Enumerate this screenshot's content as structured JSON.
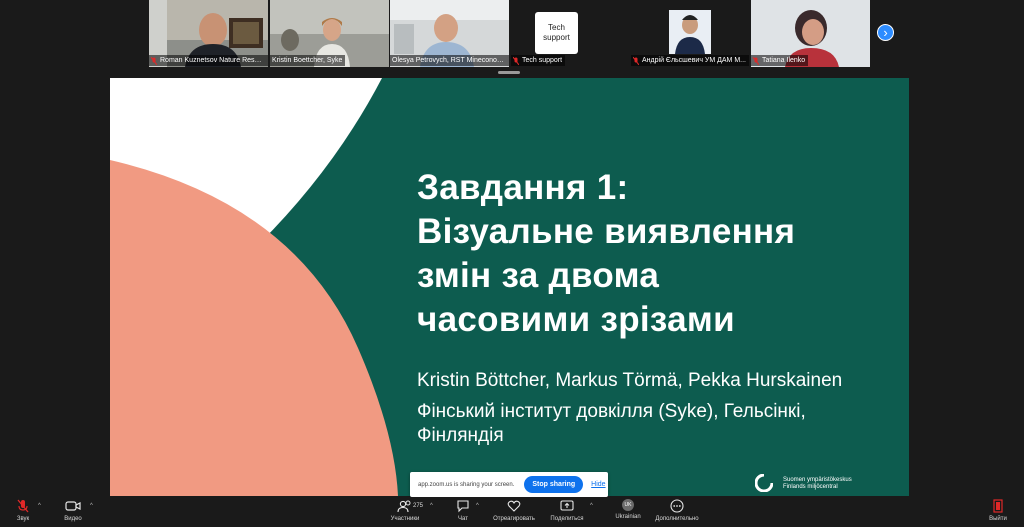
{
  "participants": [
    {
      "name": "Roman Kuznetsov Nature Reser...",
      "muted": true
    },
    {
      "name": "Kristin Boettcher, Syke",
      "muted": false
    },
    {
      "name": "Olesya Petrovych, RST Mineconomy...",
      "muted": false,
      "active": true
    },
    {
      "name": "Tech support",
      "muted": true,
      "card_text": "Tech\nsupport"
    },
    {
      "name": "Андрій Єльсшевич  УМ ДАМ М...",
      "muted": true
    },
    {
      "name": "Tatiana Ilenko",
      "muted": true
    }
  ],
  "slide": {
    "title_lines": [
      "Завдання 1:",
      "Візуальне виявлення",
      "змін за двома",
      "часовими зрізами"
    ],
    "authors": "Kristin Böttcher, Markus Törmä, Pekka Hurskainen",
    "affiliation_lines": [
      "Фінський інститут довкілля (Syke), Гельсінкі,",
      "Фінляндія"
    ],
    "logo_line1": "Suomen ympäristökeskus",
    "logo_line2": "Finlands miljöcentral"
  },
  "share_banner": {
    "message": "app.zoom.us is sharing your screen.",
    "stop_label": "Stop sharing",
    "hide_label": "Hide"
  },
  "toolbar": {
    "audio_label": "Звук",
    "video_label": "Видео",
    "participants_label": "Участники",
    "participants_count": "275",
    "chat_label": "Чат",
    "react_label": "Отреагировать",
    "share_label": "Поделиться",
    "language_label": "Ukrainian",
    "language_badge": "UK",
    "more_label": "Дополнительно",
    "leave_label": "Выйти"
  },
  "colors": {
    "slide_bg": "#0d5c4f",
    "salmon": "#f19a82",
    "zoom_blue": "#0e72ed",
    "muted_red": "#e02828"
  }
}
